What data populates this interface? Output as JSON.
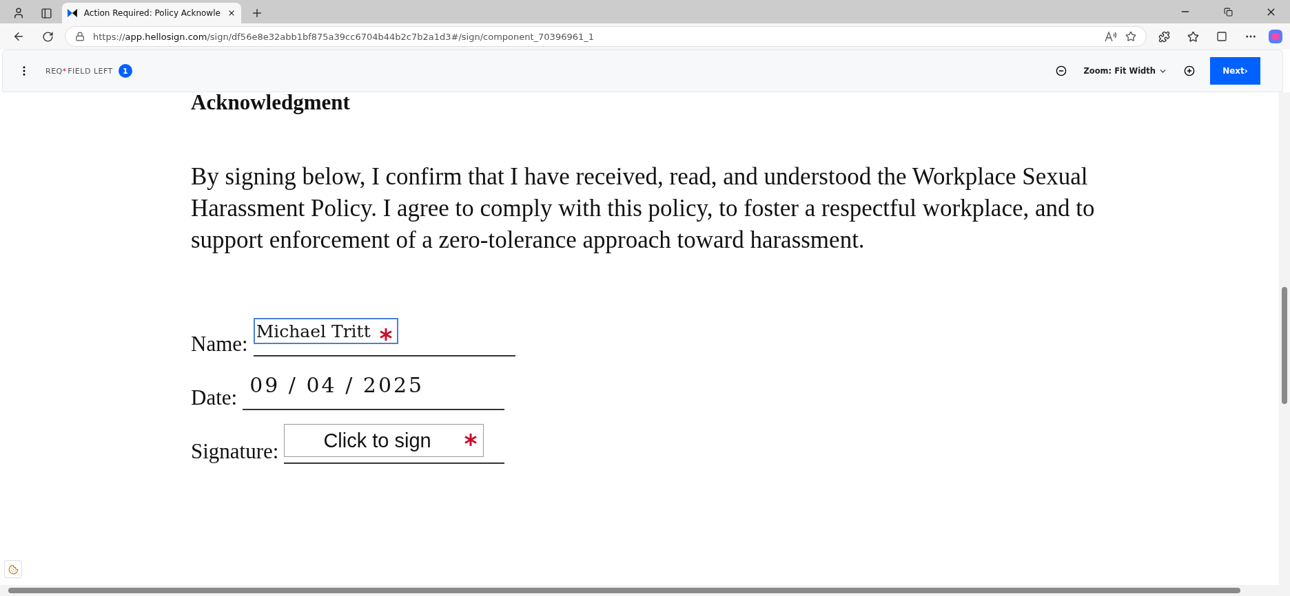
{
  "browser": {
    "tab": {
      "title": "Action Required: Policy Acknowle",
      "selected": true
    },
    "url": {
      "scheme": "https://",
      "host": "app.hellosign.com",
      "path": "/sign/df56e8e32abb1bf875a39cc6704b44b2c7b2a1d3#/sign/component_70396961_1"
    }
  },
  "toolbar": {
    "req_label": "REQ",
    "req_mark": "*",
    "label": "FIELD LEFT",
    "count": "1",
    "zoom": "Zoom: Fit Width",
    "next": "Next›"
  },
  "document": {
    "heading": "Acknowledgment",
    "paragraph": "By signing below, I confirm that I have received, read, and understood the Workplace Sexual Harassment Policy. I agree to comply with this policy, to foster a respectful workplace, and to support enforcement of a zero-tolerance approach toward harassment.",
    "fields": [
      {
        "kind": "text",
        "label": "Name:",
        "value": "Michael Tritt",
        "required": true,
        "focused": true
      },
      {
        "kind": "date",
        "label": "Date:",
        "value": "09 / 04 / 2025",
        "required": false,
        "focused": false
      },
      {
        "kind": "signature",
        "label": "Signature:",
        "value": "Click to sign",
        "required": true,
        "focused": false
      }
    ]
  }
}
